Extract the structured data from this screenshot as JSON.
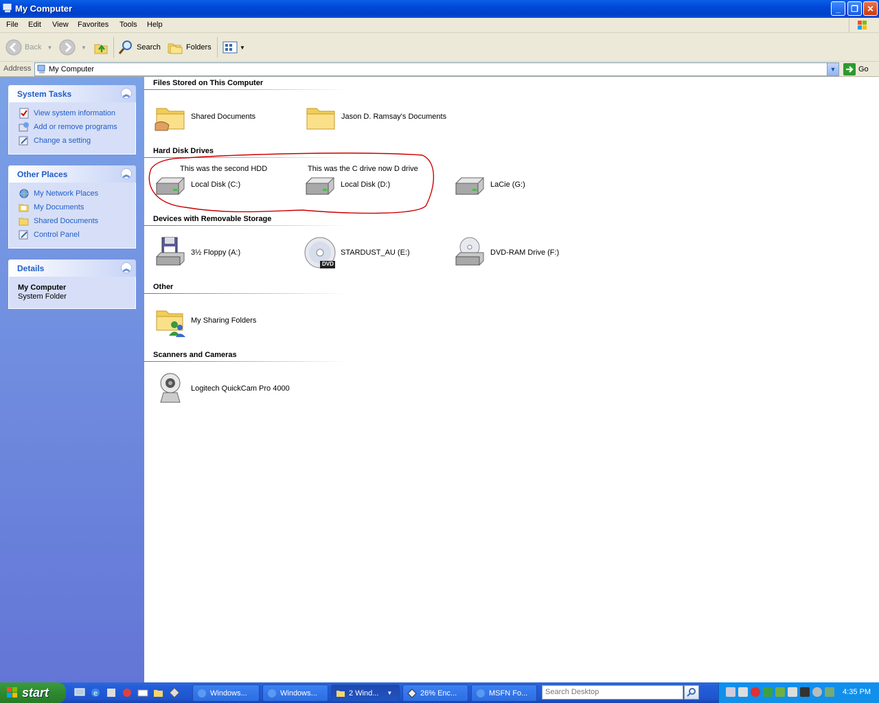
{
  "window": {
    "title": "My Computer"
  },
  "menu": [
    "File",
    "Edit",
    "View",
    "Favorites",
    "Tools",
    "Help"
  ],
  "toolbar": {
    "back": "Back",
    "search": "Search",
    "folders": "Folders"
  },
  "address": {
    "label": "Address",
    "value": "My Computer",
    "go": "Go"
  },
  "sidebar": {
    "system_tasks": {
      "title": "System Tasks",
      "items": [
        "View system information",
        "Add or remove programs",
        "Change a setting"
      ]
    },
    "other_places": {
      "title": "Other Places",
      "items": [
        "My Network Places",
        "My Documents",
        "Shared Documents",
        "Control Panel"
      ]
    },
    "details": {
      "title": "Details",
      "name": "My Computer",
      "type": "System Folder"
    }
  },
  "groups": {
    "files": {
      "title": "Files Stored on This Computer",
      "items": [
        "Shared Documents",
        "Jason D. Ramsay's Documents"
      ]
    },
    "hdd": {
      "title": "Hard Disk Drives",
      "items": [
        "Local Disk (C:)",
        "Local Disk (D:)",
        "LaCie (G:)"
      ],
      "notes": [
        "This was the second HDD",
        "This was the C drive now D drive"
      ]
    },
    "removable": {
      "title": "Devices with Removable Storage",
      "items": [
        "3½ Floppy (A:)",
        "STARDUST_AU (E:)",
        "DVD-RAM Drive (F:)"
      ],
      "dvd_badge": "DVD"
    },
    "other": {
      "title": "Other",
      "items": [
        "My Sharing Folders"
      ]
    },
    "scanners": {
      "title": "Scanners and Cameras",
      "items": [
        "Logitech QuickCam Pro 4000"
      ]
    }
  },
  "taskbar": {
    "start": "start",
    "buttons": [
      "Windows...",
      "Windows...",
      "2 Wind...",
      "26% Enc...",
      "MSFN Fo..."
    ],
    "search_placeholder": "Search Desktop",
    "clock": "4:35 PM"
  },
  "colors": {
    "title_bar": "#0a52e0",
    "sidebar_link": "#215dc6",
    "annotation": "#cc0000",
    "start": "#2f8a2f"
  }
}
